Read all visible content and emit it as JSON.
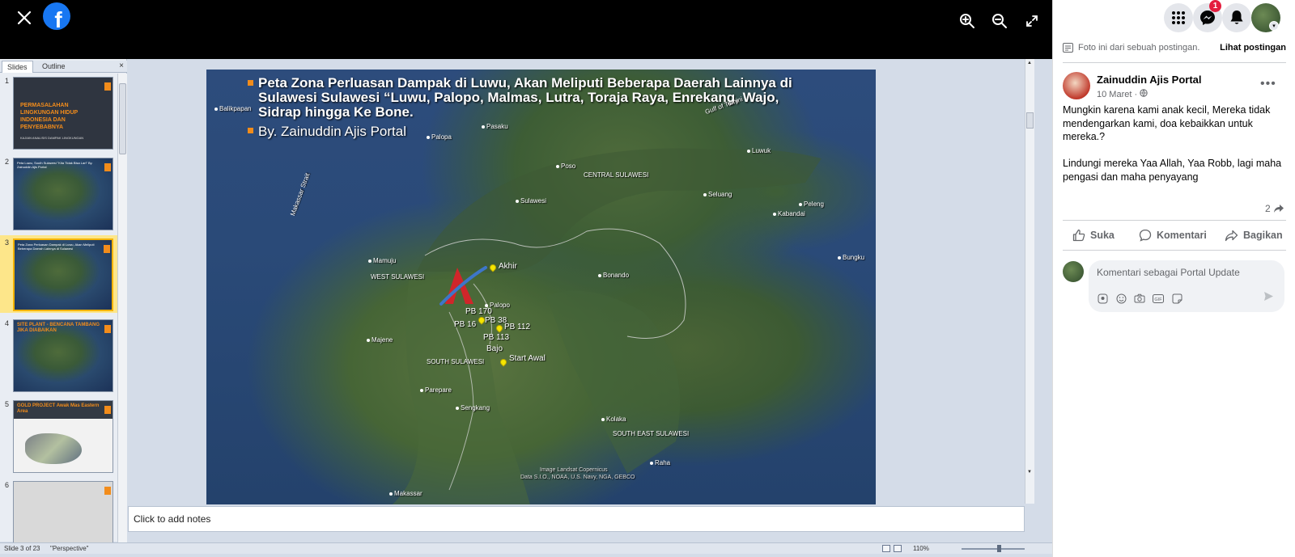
{
  "topbar": {
    "close_icon": "close-icon",
    "brand": "f",
    "zoom_in_icon": "zoom-in-icon",
    "zoom_out_icon": "zoom-out-icon",
    "fullscreen_icon": "fullscreen-icon"
  },
  "ppt": {
    "tabs": {
      "slides": "Slides",
      "outline": "Outline",
      "close": "×"
    },
    "thumbnails": [
      {
        "num": "1",
        "title": "PERMASALAHAN LINGKUNGAN HIDUP INDONESIA DAN PENYEBABNYA",
        "sub": "KAJIAN ANALISIS DAMPAK LINGKUNGAN"
      },
      {
        "num": "2",
        "text": "Peta Luwu, South Sulawesi \"Kita Tidak Bisa Lari\" By. Zainuddin Ajis Portal"
      },
      {
        "num": "3",
        "text": "Peta Zona Perluasan Dampak di Luwu, Akan Meliputi Beberapa Daerah Lainnya di Sulawesi"
      },
      {
        "num": "4",
        "text": "SITE PLANT - BENCANA TAMBANG JIKA DIABAIKAN"
      },
      {
        "num": "5",
        "text": "GOLD PROJECT Awak Mas Eastern Area"
      },
      {
        "num": "6",
        "text": ""
      }
    ],
    "slide": {
      "title": "Peta Zona Perluasan Dampak di Luwu, Akan Meliputi Beberapa Daerah Lainnya di Sulawesi Sulawesi “Luwu, Palopo, Malmas, Lutra, Toraja Raya, Enrekang, Wajo, Sidrap hingga Ke Bone.",
      "author": "By. Zainuddin Ajis Portal",
      "places": {
        "balikpapan": "Balikpapan",
        "makassar_strait": "Makassar Strait",
        "palopo_top": "Palopa",
        "pasaku": "Pasaku",
        "poso": "Poso",
        "central": "CENTRAL SULAWESI",
        "gulf": "Gulf of Tomini",
        "luwuk": "Luwuk",
        "sulawesi": "Sulawesi",
        "seluang": "Seluang",
        "peleng": "Peleng",
        "banggai": "Kabandai",
        "mamuju": "Mamuju",
        "west": "WEST SULAWESI",
        "bonando": "Bonando",
        "bungku": "Bungku",
        "palopo": "Palopo",
        "majene": "Majene",
        "south": "SOUTH SULAWESI",
        "parepare": "Parepare",
        "sengkang": "Sengkang",
        "kolaka": "Kolaka",
        "southeast": "SOUTH EAST SULAWESI",
        "raha": "Raha",
        "makassar": "Makassar"
      },
      "markers": {
        "akhir": "Akhir",
        "pb170": "PB 170",
        "pb16": "PB 16",
        "pb38": "PB 38",
        "pb112": "PB 112",
        "pb113": "PB 113",
        "bajo": "Bajo",
        "start": "Start Awal"
      },
      "credits": {
        "line1": "Image Landsat   Copernicus",
        "line2": "Data S.I.O., NOAA, U.S. Navy, NGA, GEBCO"
      }
    },
    "notes_placeholder": "Click to add notes",
    "status": {
      "slide_count": "Slide 3 of 23",
      "theme": "\"Perspective\"",
      "zoom": "110%"
    }
  },
  "facebook": {
    "messenger_badge": "1",
    "post_note": "Foto ini dari sebuah postingan.",
    "view_post": "Lihat postingan",
    "author": "Zainuddin Ajis Portal",
    "date": "10 Maret · ",
    "body": "Mungkin karena kami anak kecil, Mereka tidak mendengarkan kami, doa kebaikkan untuk mereka.?\n\nLindungi mereka Yaa Allah, Yaa Robb, lagi maha pengasi dan maha penyayang",
    "share_count": "2",
    "actions": {
      "like": "Suka",
      "comment": "Komentari",
      "share": "Bagikan"
    },
    "comment_placeholder": "Komentari sebagai Portal Update"
  }
}
